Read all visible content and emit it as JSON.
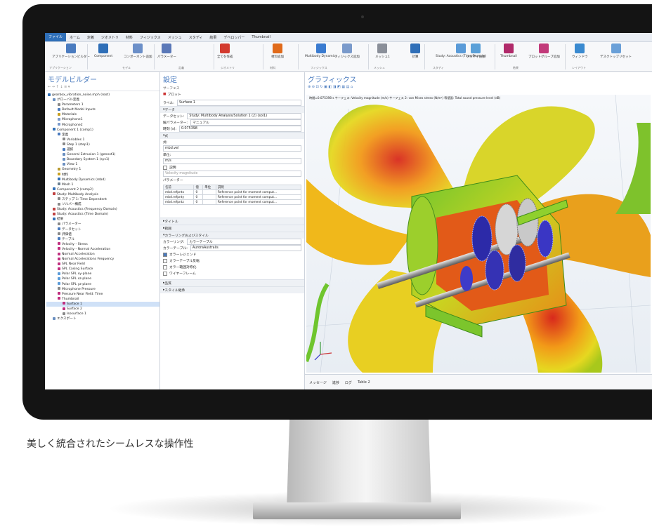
{
  "menubar": {
    "items": [
      "ファイル",
      "ホーム",
      "定義",
      "ジオメトリ",
      "材料",
      "フィジックス",
      "メッシュ",
      "スタディ",
      "結果",
      "デベロッパー",
      "Thumbnail"
    ]
  },
  "ribbon": {
    "buttons": [
      "アプリケーションビルダー",
      "Component",
      "コンポーネント追加",
      "パラメーター",
      "全てを作成",
      "材料追加",
      "Multibody Dynamics",
      "フィジックス追加",
      "メッシュ1",
      "計算",
      "Study: Acoustics (Time Domain)",
      "スタディ追加",
      "Thumbnail",
      "プロットグループ追加",
      "ウィンドウ",
      "デスクトップリセット"
    ],
    "groups": [
      "アプリケーション",
      "モデル",
      "定義",
      "ジオメトリ",
      "材料",
      "フィジックス",
      "メッシュ",
      "スタディ",
      "結果",
      "レイアウト"
    ]
  },
  "model_builder": {
    "title": "モデルビルダー",
    "tree": [
      "gearbox_vibration_noise.mph (root)",
      "グローバル定義",
      "Parameters 1",
      "Default Model Inputs",
      "Materials",
      "Microphone1",
      "Microphone2",
      "Component 1 (comp1)",
      "定義",
      "Variables 1",
      "Step 1 (step1)",
      "選択",
      "General Extrusion 1 (genext1)",
      "Boundary System 1 (sys1)",
      "View 1",
      "Geometry 1",
      "材料",
      "Multibody Dynamics (mbd)",
      "Mesh 1",
      "Component 2 (comp2)",
      "Study: Multibody Analysis",
      "ステップ 1: Time Dependent",
      "ソルバー構成",
      "Study: Acoustics (Frequency Domain)",
      "Study: Acoustics (Time Domain)",
      "結果",
      "パラメーター",
      "データセット",
      "評価値",
      "テーブル",
      "Velocity - Stress",
      "Velocity - Normal Acceleration",
      "Normal Acceleration",
      "Normal Accelerations Frequency",
      "SPL Near Field",
      "SPL Casing Surface",
      "Polar SPL xy-plane",
      "Polar SPL xz-plane",
      "Polar SPL yz-plane",
      "Microphone Pressure",
      "Pressure Near Field: Time",
      "Thumbnail",
      "Surface 1",
      "Surface 2",
      "Isosurface 1",
      "エクスポート"
    ]
  },
  "settings": {
    "title": "設定",
    "subtitle": "サーフェス",
    "plot_label": "プロット",
    "label_caption": "ラベル:",
    "label_value": "Surface 1",
    "sec_data": "データ",
    "dataset_caption": "データセット:",
    "dataset_value": "Study: Multibody Analysis/Solution 1 (2) (sol1)",
    "param_caption": "解パラメーター:",
    "param_value": "マニュアル",
    "time_caption": "時刻 (s):",
    "time_value": "0.075398",
    "sec_expr": "式",
    "expr_caption": "式:",
    "expr_value": "mbd.vel",
    "unit_caption": "単位:",
    "unit_value": "m/s",
    "desc_check": "説明",
    "desc_value": "Velocity magnitude",
    "param_sub": "パラメーター",
    "table_head": [
      "名前",
      "値",
      "単位",
      "説明"
    ],
    "table_rows": [
      [
        "mbd.refpntx",
        "0",
        "",
        "Reference point for moment comput..."
      ],
      [
        "mbd.refpnty",
        "0",
        "",
        "Reference point for moment comput..."
      ],
      [
        "mbd.refpntz",
        "0",
        "",
        "Reference point for moment comput..."
      ]
    ],
    "sec_title": "タイトル",
    "sec_range": "範囲",
    "sec_coloring": "カラーリングおよびスタイル",
    "coloring_caption": "カラーリング:",
    "coloring_value": "カラーテーブル",
    "ctable_caption": "カラーテーブル:",
    "ctable_value": "AuroraAustralis",
    "checks": [
      "カラーレジェンド",
      "カラーテーブル反転",
      "カラー範囲対称化",
      "ワイヤーフレーム"
    ],
    "sec_quality": "品質",
    "sec_inherit": "スタイル継承"
  },
  "graphics": {
    "title": "グラフィックス",
    "overlay": "時間=0.075398 s    サーフェス: Velocity magnitude (m/s)  サーフェス 2: von Mises stress (N/m²)  等値面: Total sound pressure level (dB)",
    "tabs": [
      "メッセージ",
      "進捗",
      "ログ",
      "Table 2"
    ]
  },
  "caption": "美しく統合されたシームレスな操作性"
}
